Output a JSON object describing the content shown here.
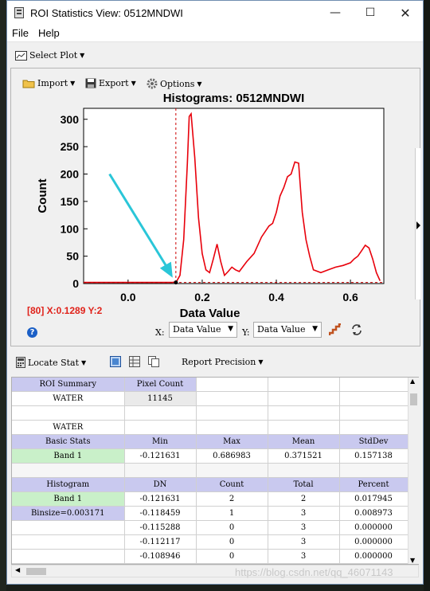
{
  "window": {
    "title": "ROI Statistics View: 0512MNDWI"
  },
  "menu": {
    "file": "File",
    "help": "Help"
  },
  "toolbar": {
    "select_plot": "Select Plot"
  },
  "plot_toolbar": {
    "import": "Import",
    "export": "Export",
    "options": "Options"
  },
  "chart_data": {
    "type": "line",
    "title": "Histograms: 0512MNDWI",
    "xlabel": "Data Value",
    "ylabel": "Count",
    "xlim": [
      -0.12,
      0.69
    ],
    "ylim": [
      0,
      320
    ],
    "xticks": [
      "0.0",
      "0.2",
      "0.4",
      "0.6"
    ],
    "yticks": [
      "0",
      "50",
      "100",
      "150",
      "200",
      "250",
      "300"
    ],
    "series_color": "#e8000b",
    "cursor_x": 0.1289,
    "grid": false,
    "x": [
      -0.12,
      -0.05,
      0.0,
      0.05,
      0.1,
      0.12,
      0.13,
      0.14,
      0.15,
      0.16,
      0.165,
      0.17,
      0.18,
      0.19,
      0.2,
      0.21,
      0.22,
      0.23,
      0.24,
      0.25,
      0.26,
      0.27,
      0.28,
      0.29,
      0.3,
      0.32,
      0.34,
      0.36,
      0.38,
      0.39,
      0.4,
      0.41,
      0.42,
      0.43,
      0.44,
      0.45,
      0.46,
      0.47,
      0.48,
      0.49,
      0.5,
      0.52,
      0.54,
      0.56,
      0.58,
      0.6,
      0.61,
      0.62,
      0.63,
      0.64,
      0.65,
      0.66,
      0.67,
      0.68
    ],
    "y": [
      2,
      2,
      2,
      2,
      2,
      2,
      3,
      15,
      80,
      220,
      305,
      310,
      230,
      120,
      55,
      25,
      20,
      45,
      72,
      40,
      15,
      22,
      30,
      25,
      22,
      40,
      55,
      85,
      105,
      110,
      130,
      160,
      175,
      195,
      200,
      222,
      220,
      130,
      80,
      50,
      25,
      20,
      25,
      30,
      33,
      38,
      45,
      50,
      60,
      70,
      65,
      45,
      20,
      5
    ]
  },
  "status": {
    "readout": "[80] X:0.1289 Y:2"
  },
  "axis_select": {
    "x_label": "X:",
    "x_value": "Data Value",
    "y_label": "Y:",
    "y_value": "Data Value"
  },
  "bottom_toolbar": {
    "locate_stat": "Locate Stat",
    "report_precision": "Report Precision"
  },
  "stats": {
    "roi_summary_header": "ROI Summary",
    "pixel_count_header": "Pixel Count",
    "roi_name": "WATER",
    "pixel_count": "11145",
    "roi_name2": "WATER",
    "basic_headers": [
      "Basic Stats",
      "Min",
      "Max",
      "Mean",
      "StdDev"
    ],
    "band1": [
      "Band 1",
      "-0.121631",
      "0.686983",
      "0.371521",
      "0.157138"
    ],
    "hist_headers": [
      "Histogram",
      "DN",
      "Count",
      "Total",
      "Percent"
    ],
    "hist_rows": [
      [
        "Band 1",
        "-0.121631",
        "2",
        "2",
        "0.017945"
      ],
      [
        "Binsize=0.003171",
        "-0.118459",
        "1",
        "3",
        "0.008973"
      ],
      [
        "",
        "-0.115288",
        "0",
        "3",
        "0.000000"
      ],
      [
        "",
        "-0.112117",
        "0",
        "3",
        "0.000000"
      ],
      [
        "",
        "-0.108946",
        "0",
        "3",
        "0.000000"
      ]
    ]
  },
  "watermark": "https://blog.csdn.net/qq_46071143"
}
